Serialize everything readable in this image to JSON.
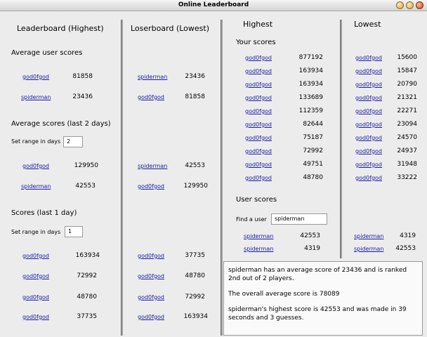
{
  "window": {
    "title": "Online Leaderboard"
  },
  "highest_board": {
    "heading": "Leaderboard (Highest)",
    "avg_label": "Average user scores",
    "avg_rows": [
      {
        "user": "god0fgod",
        "score": "81858"
      },
      {
        "user": "spiderman",
        "score": "23436"
      }
    ],
    "avg2_label": "Average scores (last 2 days)",
    "range_label": "Set range in days",
    "range2_value": "2",
    "avg2_rows": [
      {
        "user": "god0fgod",
        "score": "129950"
      },
      {
        "user": "spiderman",
        "score": "42553"
      }
    ],
    "scores1_label": "Scores (last 1 day)",
    "range1_value": "1",
    "scores1_rows": [
      {
        "user": "god0fgod",
        "score": "163934"
      },
      {
        "user": "god0fgod",
        "score": "72992"
      },
      {
        "user": "god0fgod",
        "score": "48780"
      },
      {
        "user": "god0fgod",
        "score": "37735"
      }
    ]
  },
  "lowest_board": {
    "heading": "Loserboard (Lowest)",
    "avg_rows": [
      {
        "user": "spiderman",
        "score": "23436"
      },
      {
        "user": "god0fgod",
        "score": "81858"
      }
    ],
    "avg2_rows": [
      {
        "user": "spiderman",
        "score": "42553"
      },
      {
        "user": "god0fgod",
        "score": "129950"
      }
    ],
    "scores1_rows": [
      {
        "user": "god0fgod",
        "score": "37735"
      },
      {
        "user": "god0fgod",
        "score": "48780"
      },
      {
        "user": "god0fgod",
        "score": "72992"
      },
      {
        "user": "god0fgod",
        "score": "163934"
      }
    ]
  },
  "your_scores": {
    "highest_heading": "Highest",
    "lowest_heading": "Lowest",
    "label": "Your scores",
    "highest_rows": [
      {
        "user": "god0fgod",
        "score": "877192"
      },
      {
        "user": "god0fgod",
        "score": "163934"
      },
      {
        "user": "god0fgod",
        "score": "163934"
      },
      {
        "user": "god0fgod",
        "score": "133689"
      },
      {
        "user": "god0fgod",
        "score": "112359"
      },
      {
        "user": "god0fgod",
        "score": "82644"
      },
      {
        "user": "god0fgod",
        "score": "75187"
      },
      {
        "user": "god0fgod",
        "score": "72992"
      },
      {
        "user": "god0fgod",
        "score": "49751"
      },
      {
        "user": "god0fgod",
        "score": "48780"
      }
    ],
    "lowest_rows": [
      {
        "user": "god0fgod",
        "score": "15600"
      },
      {
        "user": "god0fgod",
        "score": "15847"
      },
      {
        "user": "god0fgod",
        "score": "20790"
      },
      {
        "user": "god0fgod",
        "score": "21321"
      },
      {
        "user": "god0fgod",
        "score": "22271"
      },
      {
        "user": "god0fgod",
        "score": "23094"
      },
      {
        "user": "god0fgod",
        "score": "24570"
      },
      {
        "user": "god0fgod",
        "score": "24937"
      },
      {
        "user": "god0fgod",
        "score": "31948"
      },
      {
        "user": "god0fgod",
        "score": "33222"
      }
    ]
  },
  "user_scores": {
    "label": "User scores",
    "find_label": "Find a user",
    "find_value": "spiderman",
    "highest_rows": [
      {
        "user": "spiderman",
        "score": "42553"
      },
      {
        "user": "spiderman",
        "score": "4319"
      }
    ],
    "lowest_rows": [
      {
        "user": "spiderman",
        "score": "4319"
      },
      {
        "user": "spiderman",
        "score": "42553"
      }
    ]
  },
  "info": {
    "line1": "spiderman has an average score of 23436 and is ranked 2nd out of 2 players.",
    "line2": "The overall average score is 78089",
    "line3": "spiderman's highest score is 42553 and was made in 39 seconds and 3 guesses."
  }
}
